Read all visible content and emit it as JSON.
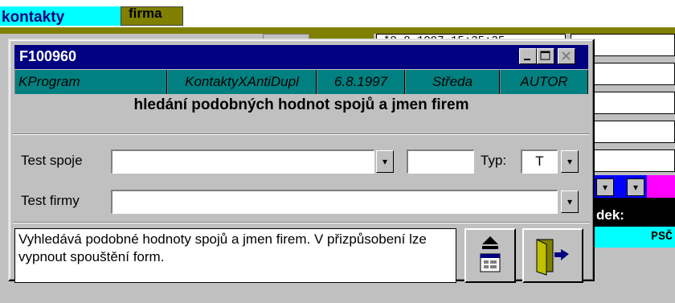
{
  "background": {
    "tabs": [
      {
        "label": "kontakty"
      },
      {
        "label": "firma"
      }
    ],
    "date_value": "*8.8.1997 15:35:35",
    "right_label_dark": "dek:",
    "right_label_cyan": "PSČ"
  },
  "dialog": {
    "title": "F100960",
    "window_buttons": {
      "minimize": "minimize",
      "maximize": "maximize",
      "close": "close"
    },
    "info": {
      "program": "KProgram",
      "module": "KontaktyXAntiDupl",
      "date": "6.8.1997",
      "day": "Středa",
      "author": "AUTOR"
    },
    "heading": "hledání podobných hodnot spojů a jmen firem",
    "fields": {
      "test_spoje_label": "Test spoje",
      "test_spoje_value": "",
      "test_spoje_extra": "",
      "typ_label": "Typ:",
      "typ_value": "T",
      "test_firmy_label": "Test firmy",
      "test_firmy_value": ""
    },
    "description": "Vyhledává podobné hodnoty spojů a jmen firem. V přizpůsobení lze vypnout spouštění form.",
    "buttons": {
      "run": "run-form-icon",
      "exit": "exit-door-icon"
    }
  },
  "colors": {
    "title": "#000080",
    "info": "#008080",
    "accent_cyan": "#00ffff",
    "olive": "#808000"
  }
}
